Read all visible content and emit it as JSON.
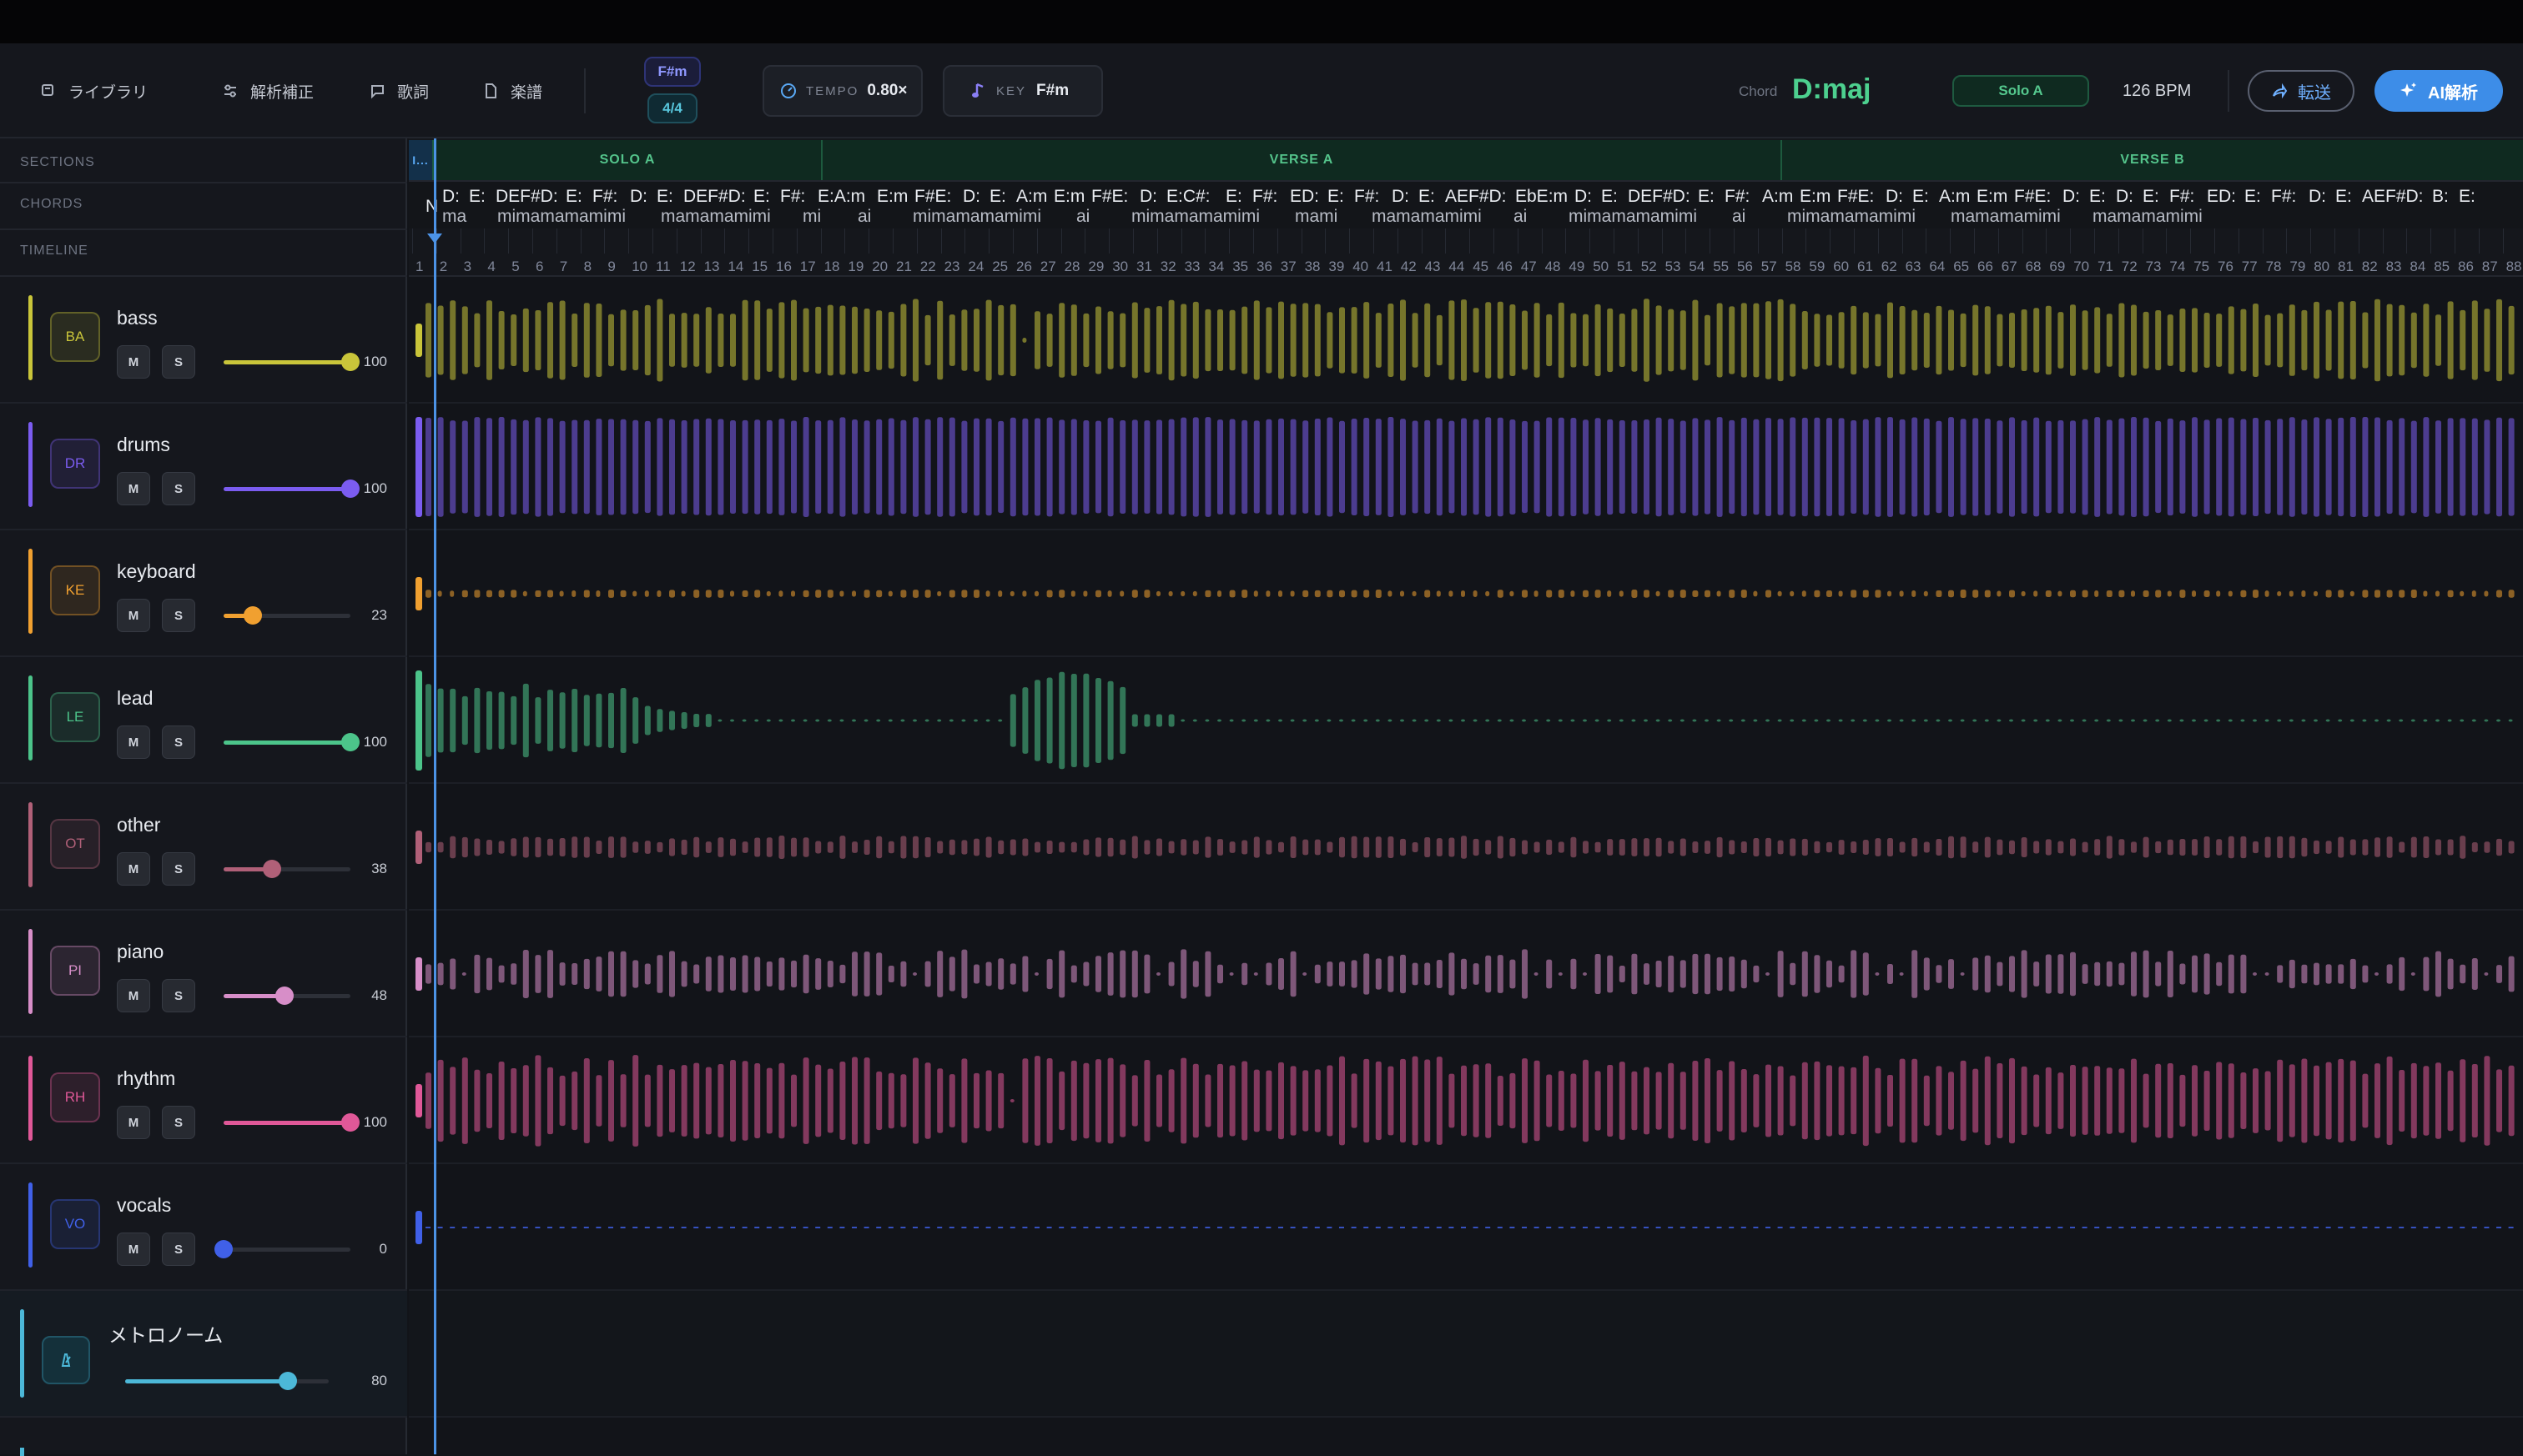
{
  "toolbar": {
    "library": "ライブラリ",
    "analysis_fix": "解析補正",
    "lyrics": "歌詞",
    "score": "楽譜",
    "key_chip": "F#m",
    "time_sig": "4/4",
    "tempo_label": "TEMPO",
    "tempo_value": "0.80×",
    "key_label": "KEY",
    "key_value": "F#m",
    "chord_label": "Chord",
    "chord_value": "D:maj",
    "section_badge": "Solo A",
    "bpm": "126 BPM",
    "transfer": "転送",
    "ai": "AI解析"
  },
  "sidebar": {
    "sections_label": "SECTIONS",
    "chords_label": "CHORDS",
    "timeline_label": "TIMELINE"
  },
  "tracks": [
    {
      "abbr": "BA",
      "name": "bass",
      "volume": 100,
      "color": "#c9c53a",
      "wave": "bars"
    },
    {
      "abbr": "DR",
      "name": "drums",
      "volume": 100,
      "color": "#7b5cf0",
      "wave": "tall"
    },
    {
      "abbr": "KE",
      "name": "keyboard",
      "volume": 23,
      "color": "#f0a030",
      "wave": "dots"
    },
    {
      "abbr": "LE",
      "name": "lead",
      "volume": 100,
      "color": "#4cc48a",
      "wave": "lead"
    },
    {
      "abbr": "OT",
      "name": "other",
      "volume": 38,
      "color": "#b06078",
      "wave": "small"
    },
    {
      "abbr": "PI",
      "name": "piano",
      "volume": 48,
      "color": "#d78ec8",
      "wave": "medium"
    },
    {
      "abbr": "RH",
      "name": "rhythm",
      "volume": 100,
      "color": "#e05898",
      "wave": "large"
    },
    {
      "abbr": "VO",
      "name": "vocals",
      "volume": 0,
      "color": "#4060e8",
      "wave": "flat"
    }
  ],
  "metronome": {
    "name": "メトロノーム",
    "volume": 80,
    "color": "#4cb8d8"
  },
  "mute_label": "M",
  "solo_label": "S",
  "sections": [
    {
      "label": "I..."
    },
    {
      "label": "SOLO A"
    },
    {
      "label": "VERSE A"
    },
    {
      "label": "VERSE B"
    }
  ],
  "chord_first": "N",
  "chords_top": [
    "D:",
    "E:",
    "DEF#D:",
    "E:",
    "F#:",
    "D:",
    "E:",
    "DEF#D:",
    "E:",
    "F#:",
    "E:A:m",
    "E:m",
    "F#E:",
    "D:",
    "E:",
    "A:m",
    "E:m",
    "F#E:",
    "D:",
    "E:C#:",
    "E:",
    "F#:",
    "ED:",
    "E:",
    "F#:",
    "D:",
    "E:",
    "AEF#D:",
    "EbE:m",
    "D:",
    "E:",
    "DEF#D:",
    "E:",
    "F#:",
    "A:m",
    "E:m",
    "F#E:",
    "D:",
    "E:",
    "A:m",
    "E:m",
    "F#E:",
    "D:",
    "E:",
    "D:",
    "E:",
    "F#:",
    "ED:",
    "E:",
    "F#:",
    "D:",
    "E:",
    "AEF#D:",
    "B:",
    "E:"
  ],
  "chords_bottom": [
    "ma",
    "mimamamamimi",
    "mamamamimi",
    "mi",
    "ai",
    "mimamamamimi",
    "ai",
    "mimamamamimi",
    "mami",
    "mamamamimi",
    "ai",
    "mimamamamimi",
    "ai",
    "mimamamamimi",
    "mamamamimi",
    "mamamamimi"
  ],
  "measure_count": 88
}
